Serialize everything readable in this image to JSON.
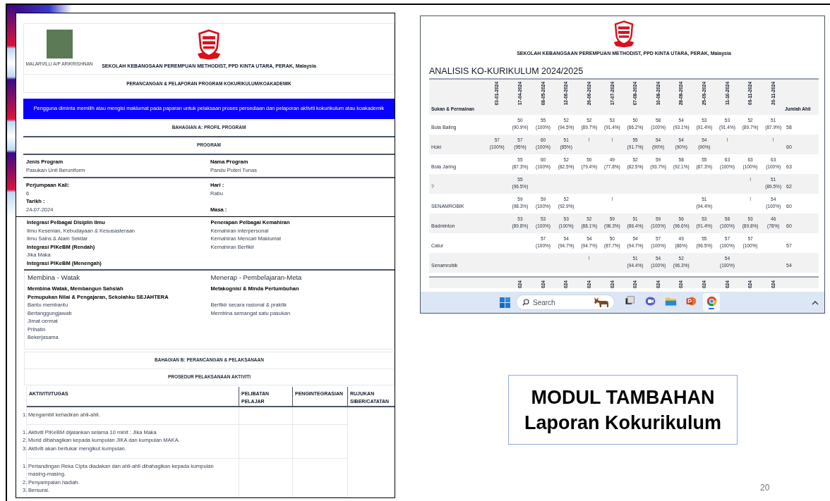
{
  "slide": {
    "title_lines": [
      "MODUL TAMBAHAN",
      "Laporan Kokurikulum"
    ],
    "page_number": "20"
  },
  "form": {
    "person_name": "MALARVILLI A/P ARIKRISHNAN",
    "school_name": "SEKOLAH KEBANGSAAN PEREMPUAN METHODIST, PPD KINTA UTARA, PERAK, Malaysia",
    "form_title": "PERANCANGAN & PELAPORAN PROGRAM KOKURIKULUM/KOAKADEMIK",
    "notice": "Pengguna diminta memilih atau mengisi maklumat pada paparan untuk pelaksaan proses persediaan dan pelaporan aktiviti kokurikulum atau koakademik",
    "section_a_title": "BAHAGIAN A: PROFIL PROGRAM",
    "program_heading": "PROGRAM",
    "profile_rows": [
      [
        [
          {
            "kind": "label",
            "text": "Jenis Program"
          },
          {
            "kind": "value",
            "text": "Pasukan Unit Beruniform"
          }
        ],
        [
          {
            "kind": "label",
            "text": "Nama Program"
          },
          {
            "kind": "value",
            "text": "Pandu Puteri Tunas"
          }
        ]
      ],
      [
        [
          {
            "kind": "label",
            "text": "Perjumpaan Kali:"
          },
          {
            "kind": "value",
            "text": "6"
          },
          {
            "kind": "label",
            "text": "Tarikh :"
          },
          {
            "kind": "value",
            "text": "24-07-2024"
          }
        ],
        [
          {
            "kind": "label",
            "text": "Hari :"
          },
          {
            "kind": "value",
            "text": "Rabu"
          },
          {
            "kind": "blank"
          },
          {
            "kind": "label",
            "text": "Masa :"
          }
        ]
      ]
    ]
  },
  "form_continued": {
    "sections": [
      {
        "columns": [
          [
            {
              "kind": "label",
              "text": "Integrasi Pelbagai Disiplin Ilmu"
            },
            {
              "kind": "value",
              "text": "Ilmu Kesenian, Kebudayaan & Kesusasteraan"
            },
            {
              "kind": "value",
              "text": "Ilmu Sains & Alam Sekitar"
            },
            {
              "kind": "label",
              "text": "Integrasi PIKeBM (Rendah)"
            },
            {
              "kind": "value",
              "text": "Jika Maka"
            },
            {
              "kind": "label",
              "text": "Integrasi PIKeBM (Menengah)"
            }
          ],
          [
            {
              "kind": "label",
              "text": "Penerapan Pelbagai Kemahiran"
            },
            {
              "kind": "value",
              "text": "Kemahiran interpersonal"
            },
            {
              "kind": "value",
              "text": "Kemahiran Mencari Maklumat"
            },
            {
              "kind": "value",
              "text": "Kemahiran Berfikir"
            }
          ]
        ]
      },
      {
        "columns": [
          [
            {
              "kind": "heading",
              "text": "Membina - Watak"
            },
            {
              "kind": "label",
              "text": "Membina Watak, Membangun Sahsiah"
            },
            {
              "kind": "label",
              "text": "Pemupukan Nilai & Pengajaran, Sekolahku SEJAHTERA"
            },
            {
              "kind": "value",
              "text": "Bantu membantu"
            },
            {
              "kind": "value",
              "text": "Bertanggungjawab"
            },
            {
              "kind": "value",
              "text": "Jimat cermat"
            },
            {
              "kind": "value",
              "text": "Prihatin"
            },
            {
              "kind": "value",
              "text": "Bekerjasama"
            }
          ],
          [
            {
              "kind": "heading",
              "text": "Menerap - Pembelajaran-Meta"
            },
            {
              "kind": "label",
              "text": "Metakognisi & Minda Pertumbuhan"
            },
            {
              "kind": "blank"
            },
            {
              "kind": "value",
              "text": "Berfikir secara rasional & praktik"
            },
            {
              "kind": "value",
              "text": "Membina semangat satu pasukan"
            }
          ]
        ]
      }
    ],
    "section_b_title": "BAHAGIAN B: PERANCANGAN & PELAKSANAAN",
    "procedure_title": "PROSEDUR PELAKSANAAN AKTIVITI",
    "activity_table": {
      "columns": [
        "AKTIVITI/TUGAS",
        "PELIBATAN PELAJAR",
        "PENGINTEGRASIAN",
        "RUJUKAN SIBER/CATATAN"
      ],
      "rows": [
        {
          "items": [
            {
              "number": "1.",
              "text": "Mengambil kehadiran ahli-ahli."
            }
          ]
        },
        {
          "items": [
            {
              "number": "1.",
              "text": "Aktiviti PIKeBM dijalankan selama 10 minit : Jika Maka"
            },
            {
              "number": "2.",
              "text": "Murid dibahagikan kepada kumpulan JIKA dan kumpulan MAKA."
            },
            {
              "number": "3.",
              "text": "Aktiviti akan bertukar mengikut kumpulan."
            }
          ]
        },
        {
          "items": [
            {
              "number": "1.",
              "text": "Pertandingan Reka Cipta diadakan dan ahli-ahli dibahagikan kepada kumpulan masing-masing."
            },
            {
              "number": "2.",
              "text": "Penyampaian hadiah."
            },
            {
              "number": "3.",
              "text": "Bersurai."
            }
          ]
        }
      ]
    }
  },
  "analysis": {
    "school_name": "SEKOLAH KEBANGSAAN PEREMPUAN METHODIST, PPD KINTA UTARA, PERAK, Malaysia",
    "title": "ANALISIS KO-KURIKULUM 2024/2025",
    "first_column": "Sukan & Permainan",
    "total_column": "Jumlah Ahli",
    "dates": [
      "03-01-2024",
      "17-04-2024",
      "08-05-2024",
      "12-06-2024",
      "26-06-2024",
      "17-07-2024",
      "07-08-2024",
      "10-08-2024",
      "28-08-2024",
      "25-09-2024",
      "11-10-2024",
      "06-11-2024",
      "20-11-2024"
    ],
    "rows": [
      {
        "name": "Bola Baling",
        "total": "58",
        "cells": [
          null,
          {
            "value": "50",
            "pct": "(90.9%)"
          },
          {
            "value": "55",
            "pct": "(100%)"
          },
          {
            "value": "52",
            "pct": "(94.5%)"
          },
          {
            "value": "52",
            "pct": "(89.7%)"
          },
          {
            "value": "53",
            "pct": "(91.4%)"
          },
          {
            "value": "50",
            "pct": "(86.2%)"
          },
          {
            "value": "58",
            "pct": "(100%)"
          },
          {
            "value": "54",
            "pct": "(93.1%)"
          },
          {
            "value": "53",
            "pct": "(91.4%)"
          },
          {
            "value": "53",
            "pct": "(91.4%)"
          },
          {
            "value": "52",
            "pct": "(89.7%)"
          },
          {
            "value": "51",
            "pct": "(87.9%)"
          }
        ]
      },
      {
        "name": "Hoki",
        "total": "60",
        "cells": [
          {
            "value": "57",
            "pct": "(100%)"
          },
          {
            "value": "57",
            "pct": "(95%)"
          },
          {
            "value": "60",
            "pct": "(100%)"
          },
          {
            "value": "51",
            "pct": "(85%)"
          },
          {
            "value": "!"
          },
          {
            "value": "!"
          },
          {
            "value": "55",
            "pct": "(91.7%)"
          },
          {
            "value": "54",
            "pct": "(90%)"
          },
          {
            "value": "54",
            "pct": "(90%)"
          },
          {
            "value": "54",
            "pct": "(90%)"
          },
          {
            "value": "!"
          },
          null,
          {
            "value": "!"
          }
        ]
      },
      {
        "name": "Bola Jaring",
        "total": "63",
        "cells": [
          null,
          {
            "value": "55",
            "pct": "(87.3%)"
          },
          {
            "value": "60",
            "pct": "(100%)"
          },
          {
            "value": "52",
            "pct": "(82.5%)"
          },
          {
            "value": "50",
            "pct": "(79.4%)"
          },
          {
            "value": "49",
            "pct": "(77.8%)"
          },
          {
            "value": "52",
            "pct": "(82.5%)"
          },
          {
            "value": "59",
            "pct": "(93.7%)"
          },
          {
            "value": "58",
            "pct": "(92.1%)"
          },
          {
            "value": "55",
            "pct": "(87.3%)"
          },
          {
            "value": "63",
            "pct": "(100%)"
          },
          {
            "value": "63",
            "pct": "(100%)"
          },
          {
            "value": "63",
            "pct": "(100%)"
          }
        ]
      },
      {
        "name": "?",
        "total": "62",
        "cells": [
          null,
          {
            "value": "55",
            "pct": "(96.5%)"
          },
          null,
          null,
          null,
          null,
          null,
          null,
          null,
          null,
          null,
          {
            "value": "!"
          },
          {
            "value": "51",
            "pct": "(89.5%)"
          }
        ]
      },
      {
        "name": "SENAMROBIK",
        "total": "60",
        "cells": [
          null,
          {
            "value": "59",
            "pct": "(98.3%)"
          },
          {
            "value": "59",
            "pct": "(100%)"
          },
          {
            "value": "52",
            "pct": "(92.9%)"
          },
          null,
          {
            "value": "!"
          },
          null,
          null,
          null,
          {
            "value": "51",
            "pct": "(94.4%)"
          },
          null,
          {
            "value": "!"
          },
          {
            "value": "54",
            "pct": "(100%)"
          }
        ]
      },
      {
        "name": "Badminton",
        "total": "60",
        "cells": [
          null,
          {
            "value": "53",
            "pct": "(89.8%)"
          },
          {
            "value": "53",
            "pct": "(100%)"
          },
          {
            "value": "53",
            "pct": "(100%)"
          },
          {
            "value": "52",
            "pct": "(88.1%)"
          },
          {
            "value": "59",
            "pct": "(98.3%)"
          },
          {
            "value": "51",
            "pct": "(86.4%)"
          },
          {
            "value": "59",
            "pct": "(100%)"
          },
          {
            "value": "56",
            "pct": "(96.6%)"
          },
          {
            "value": "53",
            "pct": "(91.4%)"
          },
          {
            "value": "58",
            "pct": "(100%)"
          },
          {
            "value": "53",
            "pct": "(89.8%)"
          },
          {
            "value": "46",
            "pct": "(78%)"
          }
        ]
      },
      {
        "name": "Catur",
        "total": "57",
        "cells": [
          null,
          null,
          {
            "value": "57",
            "pct": "(100%)"
          },
          {
            "value": "54",
            "pct": "(94.7%)"
          },
          {
            "value": "54",
            "pct": "(94.7%)"
          },
          {
            "value": "50",
            "pct": "(87.7%)"
          },
          {
            "value": "54",
            "pct": "(94.7%)"
          },
          {
            "value": "57",
            "pct": "(100%)"
          },
          {
            "value": "49",
            "pct": "(86%)"
          },
          {
            "value": "55",
            "pct": "(96.5%)"
          },
          {
            "value": "57",
            "pct": "(100%)"
          },
          {
            "value": "57",
            "pct": "(100%)"
          },
          null
        ]
      },
      {
        "name": "Senamrobik",
        "total": "54",
        "cells": [
          null,
          null,
          null,
          null,
          {
            "value": "!"
          },
          null,
          {
            "value": "51",
            "pct": "(94.4%)"
          },
          {
            "value": "54",
            "pct": "(100%)"
          },
          {
            "value": "52",
            "pct": "(96.3%)"
          },
          null,
          {
            "value": "54",
            "pct": "(100%)"
          },
          null,
          null
        ]
      }
    ],
    "repeat_header": [
      "024",
      "024",
      "024",
      "024",
      "024",
      "024",
      "024",
      "024",
      "024",
      "024",
      "024",
      "024"
    ]
  },
  "taskbar": {
    "search": {
      "placeholder": "Search"
    },
    "apps": [
      {
        "kind": "task-view",
        "selected": false
      },
      {
        "kind": "meet",
        "selected": false
      },
      {
        "kind": "folder",
        "selected": false
      },
      {
        "kind": "slides",
        "selected": false
      },
      {
        "kind": "browser",
        "selected": true
      }
    ]
  }
}
